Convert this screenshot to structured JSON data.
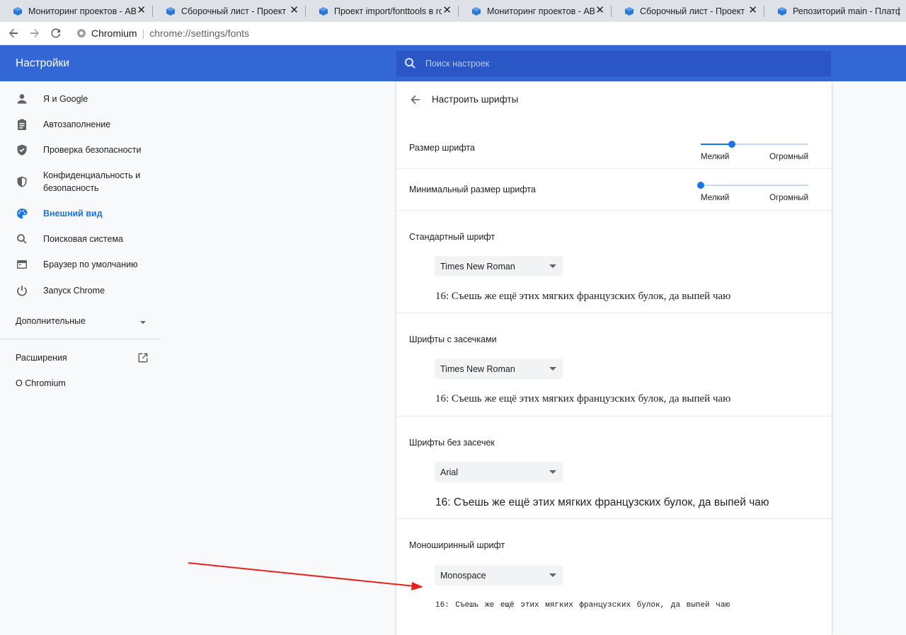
{
  "tabs": [
    {
      "title": "Мониторинг проектов - ABF",
      "close": "✕",
      "icon": "cube-icon"
    },
    {
      "title": "Сборочный лист - Проект import",
      "close": "✕",
      "icon": "cube-icon"
    },
    {
      "title": "Проект import/fonttools в rosa",
      "close": "✕",
      "icon": "cube-icon"
    },
    {
      "title": "Мониторинг проектов - ABF",
      "close": "✕",
      "icon": "cube-icon"
    },
    {
      "title": "Сборочный лист - Проект import",
      "close": "✕",
      "icon": "cube-icon"
    },
    {
      "title": "Репозиторий main - Платформа",
      "close": "",
      "icon": "cube-icon"
    }
  ],
  "toolbar": {
    "site_name": "Chromium",
    "separator": "|",
    "url": "chrome://settings/fonts"
  },
  "header": {
    "title": "Настройки",
    "search_placeholder": "Поиск настроек"
  },
  "sidebar": {
    "items": [
      {
        "label": "Я и Google",
        "icon": "person-icon"
      },
      {
        "label": "Автозаполнение",
        "icon": "clipboard-icon"
      },
      {
        "label": "Проверка безопасности",
        "icon": "shield-check-icon"
      },
      {
        "label": "Конфиденциальность и безопасность",
        "icon": "shield-icon"
      },
      {
        "label": "Внешний вид",
        "icon": "palette-icon",
        "active": true
      },
      {
        "label": "Поисковая система",
        "icon": "search-icon"
      },
      {
        "label": "Браузер по умолчанию",
        "icon": "browser-icon"
      },
      {
        "label": "Запуск Chrome",
        "icon": "power-icon"
      }
    ],
    "advanced": "Дополнительные",
    "extensions": "Расширения",
    "about": "О Chromium"
  },
  "main": {
    "title": "Настроить шрифты",
    "font_size": {
      "label": "Размер шрифта",
      "min_label": "Мелкий",
      "max_label": "Огромный",
      "level": 0.29
    },
    "min_font_size": {
      "label": "Минимальный размер шрифта",
      "min_label": "Мелкий",
      "max_label": "Огромный",
      "level": 0.0
    },
    "sections": [
      {
        "label": "Стандартный шрифт",
        "font": "Times New Roman",
        "sample": "16: Съешь же ещё этих мягких французских булок, да выпей чаю"
      },
      {
        "label": "Шрифты с засечками",
        "font": "Times New Roman",
        "sample": "16: Съешь же ещё этих мягких французских булок, да выпей чаю"
      },
      {
        "label": "Шрифты без засечек",
        "font": "Arial",
        "sample": "16: Съешь же ещё этих мягких французских булок, да выпей чаю"
      },
      {
        "label": "Моноширинный шрифт",
        "font": "Monospace",
        "sample": "16: Съешь же ещё этих мягких французских булок, да выпей чаю"
      }
    ]
  },
  "colors": {
    "header_blue": "#3367d6",
    "search_bg": "#2a56c6",
    "accent": "#1a73e8",
    "annotation_arrow": "#e8221f"
  }
}
